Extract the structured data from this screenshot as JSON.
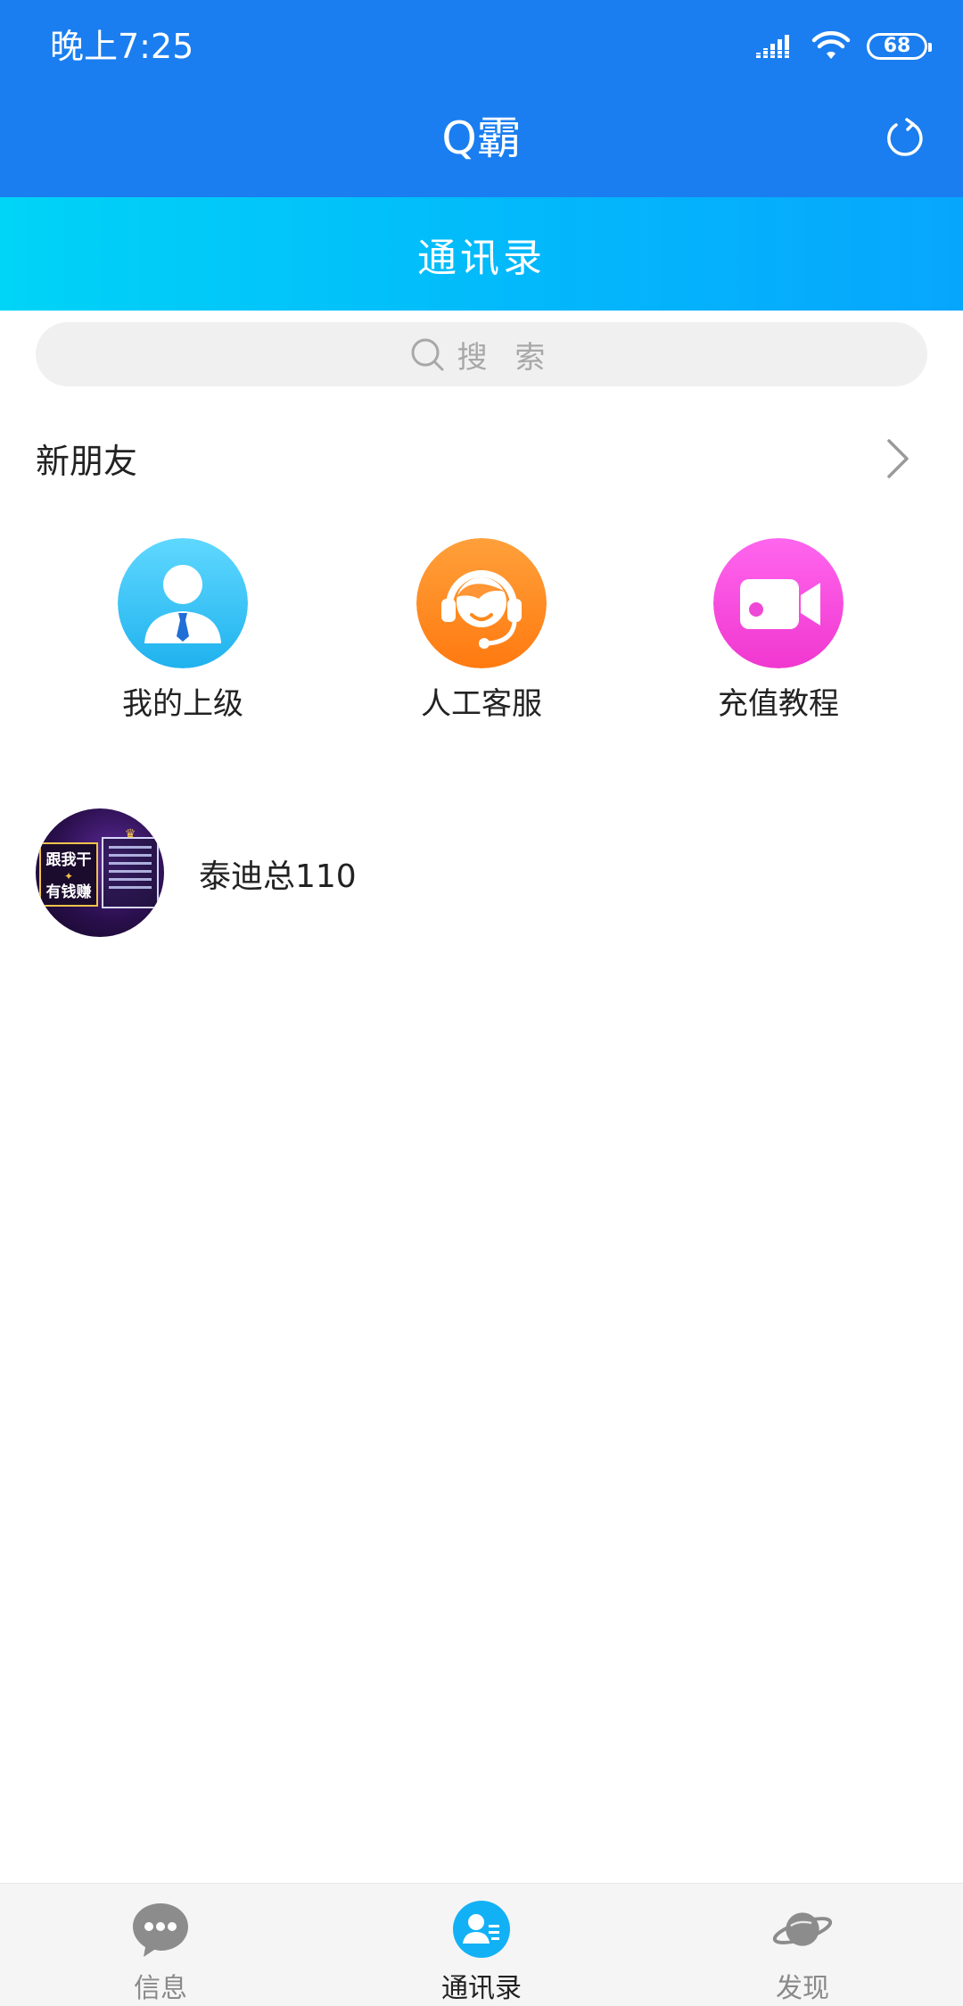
{
  "status_bar": {
    "time": "晚上7:25",
    "battery": "68"
  },
  "app_bar": {
    "title": "Q霸"
  },
  "section_bar": {
    "title": "通讯录"
  },
  "search": {
    "placeholder": "搜 索"
  },
  "new_friends": {
    "label": "新朋友"
  },
  "quick_actions": [
    {
      "label": "我的上级",
      "icon": "superior-person-icon",
      "color": "#3ec7f5"
    },
    {
      "label": "人工客服",
      "icon": "customer-service-icon",
      "color": "#ff8a1e"
    },
    {
      "label": "充值教程",
      "icon": "video-camera-icon",
      "color": "#f64de0"
    }
  ],
  "contacts": [
    {
      "name": "泰迪总110",
      "avatar_text": [
        "跟我干",
        "有钱赚"
      ]
    }
  ],
  "bottom_nav": {
    "items": [
      {
        "label": "信息",
        "icon": "chat-bubble-icon",
        "active": false
      },
      {
        "label": "通讯录",
        "icon": "contacts-icon",
        "active": true
      },
      {
        "label": "发现",
        "icon": "planet-icon",
        "active": false
      }
    ]
  },
  "colors": {
    "app_bar": "#1a7ef0",
    "accent": "#12b1f6"
  }
}
